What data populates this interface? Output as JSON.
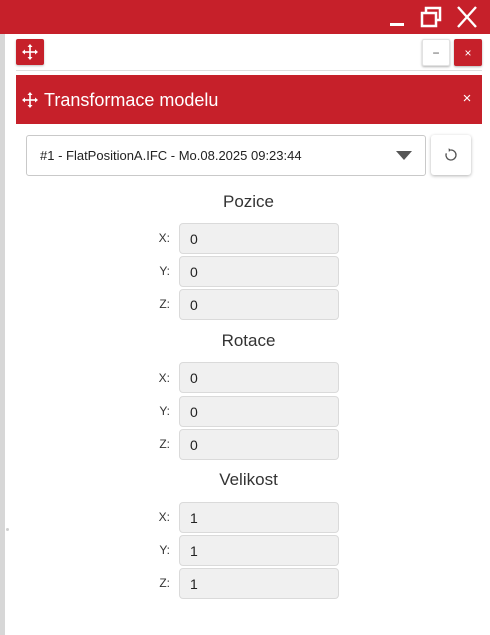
{
  "window": {
    "minimize_icon": "minimize-icon",
    "maximize_icon": "restore-icon",
    "close_icon": "close-icon",
    "accent_color": "#c6202a"
  },
  "toolbar": {
    "move_icon": "move-arrows-icon",
    "minimize_label": "−",
    "close_label": "×"
  },
  "panel": {
    "title": "Transformace modelu",
    "close_label": "×",
    "model_select": {
      "value": "#1 - FlatPositionA.IFC - Mo.08.2025 09:23:44"
    },
    "reset_icon": "refresh-icon",
    "sections": [
      {
        "title": "Pozice",
        "fields": [
          {
            "label": "X:",
            "value": "0"
          },
          {
            "label": "Y:",
            "value": "0"
          },
          {
            "label": "Z:",
            "value": "0"
          }
        ]
      },
      {
        "title": "Rotace",
        "fields": [
          {
            "label": "X:",
            "value": "0"
          },
          {
            "label": "Y:",
            "value": "0"
          },
          {
            "label": "Z:",
            "value": "0"
          }
        ]
      },
      {
        "title": "Velikost",
        "fields": [
          {
            "label": "X:",
            "value": "1"
          },
          {
            "label": "Y:",
            "value": "1"
          },
          {
            "label": "Z:",
            "value": "1"
          }
        ]
      }
    ]
  }
}
